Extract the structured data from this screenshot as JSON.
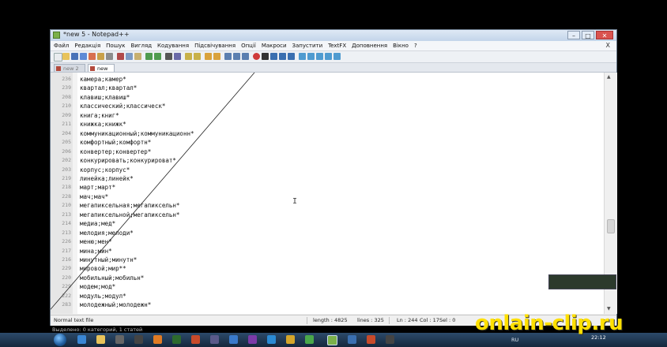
{
  "window": {
    "title": "*new 5 - Notepad++",
    "controls": [
      "–",
      "□",
      "✕"
    ]
  },
  "menu": {
    "items": [
      "Файл",
      "Редакція",
      "Пошук",
      "Вигляд",
      "Кодування",
      "Підсвічування",
      "Опції",
      "Макроси",
      "Запустити",
      "TextFX",
      "Доповнення",
      "Вікно",
      "?"
    ],
    "close": "X"
  },
  "tabs": {
    "inactive_label": "new 2 2",
    "active_label": "new 5"
  },
  "editor": {
    "lines": [
      {
        "num": "236",
        "text": "камера;камер*"
      },
      {
        "num": "239",
        "text": "квартал;квартал*"
      },
      {
        "num": "208",
        "text": "клавиш;клавиш*"
      },
      {
        "num": "210",
        "text": "классический;классическ*"
      },
      {
        "num": "209",
        "text": "книга;книг*"
      },
      {
        "num": "211",
        "text": "книжка;книжк*"
      },
      {
        "num": "204",
        "text": "коммуникационный;коммуникационн*"
      },
      {
        "num": "205",
        "text": "комфортный;комфортн*"
      },
      {
        "num": "206",
        "text": "конвертер;конвертер*"
      },
      {
        "num": "202",
        "text": "конкурировать;конкурироват*"
      },
      {
        "num": "203",
        "text": "корпус;корпус*"
      },
      {
        "num": "219",
        "text": "линейка;линейк*"
      },
      {
        "num": "218",
        "text": "март;март*"
      },
      {
        "num": "228",
        "text": "мач;мач*"
      },
      {
        "num": "210",
        "text": "мегапиксельная;мегапиксельн*"
      },
      {
        "num": "213",
        "text": "мегапиксельной;мегапиксельн*"
      },
      {
        "num": "214",
        "text": "медиа;мед*"
      },
      {
        "num": "213",
        "text": "мелодия;мелоди*"
      },
      {
        "num": "226",
        "text": "меню;мен*"
      },
      {
        "num": "217",
        "text": "мина;мин*"
      },
      {
        "num": "216",
        "text": "минутный;минутн*"
      },
      {
        "num": "229",
        "text": "мировой;мир**"
      },
      {
        "num": "220",
        "text": "мобильный;мобильн*"
      },
      {
        "num": "229",
        "text": "модем;мод*"
      },
      {
        "num": "222",
        "text": "модуль;модул*"
      },
      {
        "num": "283",
        "text": "молодежный;молодежн*"
      }
    ]
  },
  "status": {
    "mode": "Normal text file",
    "length": "length : 4825",
    "lines": "lines : 325",
    "ln": "Ln : 244",
    "col": "Col : 17",
    "sel": "Sel : 0"
  },
  "below_window_text": "Выделено: 0 категорий, 1 статей",
  "taskbar": {
    "language": "RU",
    "clock": "22:12"
  },
  "watermark": "onlain-clip.ru",
  "colors": {
    "background": "#000000",
    "watermark": "#ffe000",
    "window_bg": "#f0f0f0",
    "taskbar": "#1e3550"
  }
}
